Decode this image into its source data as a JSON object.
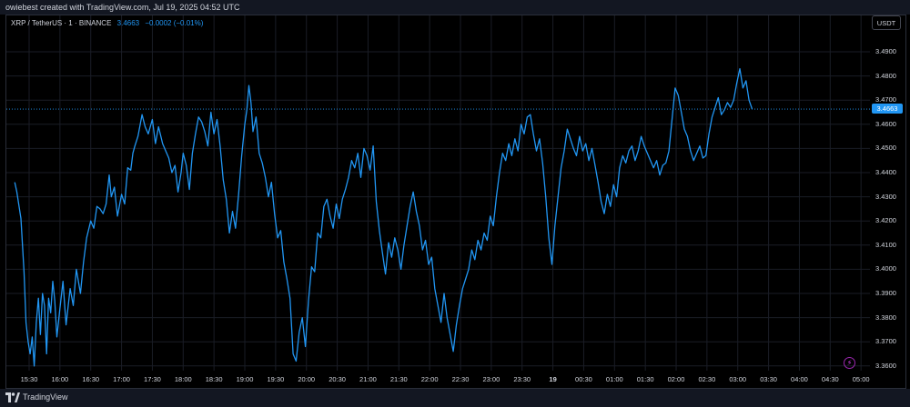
{
  "header": {
    "caption": "owiebest created with TradingView.com, Jul 19, 2025 04:52 UTC"
  },
  "legend": {
    "symbol": "XRP / TetherUS · 1 · BINANCE",
    "price": "3.4663",
    "change": "−0.0002 (−0.01%)"
  },
  "axis": {
    "currency": "USDT",
    "last_price_label": "3.4663"
  },
  "footer": {
    "brand": "TradingView"
  },
  "icons": {
    "logo": "tradingview-logo-icon",
    "replay": "lightning-icon"
  },
  "colors": {
    "line": "#2196f3",
    "background": "#000000",
    "grid": "#1a1d26"
  },
  "chart_data": {
    "type": "line",
    "title": "",
    "xlabel": "",
    "ylabel": "",
    "ylim": [
      3.355,
      3.4935
    ],
    "grid": true,
    "y_ticks": [
      "3.4900",
      "3.4800",
      "3.4700",
      "3.4600",
      "3.4500",
      "3.4400",
      "3.4300",
      "3.4200",
      "3.4100",
      "3.4000",
      "3.3900",
      "3.3800",
      "3.3700",
      "3.3600"
    ],
    "x_ticks": [
      "15:30",
      "16:00",
      "16:30",
      "17:00",
      "17:30",
      "18:00",
      "18:30",
      "19:00",
      "19:30",
      "20:00",
      "20:30",
      "21:00",
      "21:30",
      "22:00",
      "22:30",
      "23:00",
      "23:30",
      "19",
      "00:30",
      "01:00",
      "01:30",
      "02:00",
      "02:30",
      "03:00",
      "03:30",
      "04:00",
      "04:30",
      "05:00"
    ],
    "last_price": 3.4663,
    "series": [
      {
        "x_minutes_from_1530": [
          -14,
          -12,
          -8,
          -5,
          -3,
          -1,
          1,
          3,
          5,
          7,
          9,
          11,
          13,
          15,
          17,
          19,
          21,
          23,
          25,
          27,
          30,
          33,
          36,
          40,
          43,
          46,
          50,
          53,
          56,
          60,
          63,
          66,
          69,
          72,
          75,
          78,
          80,
          83,
          86,
          90,
          93,
          96,
          99,
          101,
          103,
          106,
          110,
          113,
          116,
          120,
          123,
          126,
          130,
          133,
          136,
          139,
          142,
          145,
          148,
          150,
          153,
          156,
          159,
          162,
          165,
          168,
          171,
          174,
          177,
          180,
          183,
          186,
          189,
          192,
          195,
          198,
          201,
          204,
          207,
          210,
          212,
          214,
          216,
          218,
          221,
          224,
          227,
          230,
          233,
          236,
          239,
          242,
          245,
          248,
          251,
          254,
          257,
          260,
          263,
          266,
          269,
          272,
          275,
          278,
          281,
          284,
          287,
          290,
          293,
          296,
          299,
          302,
          305,
          308,
          311,
          314,
          317,
          320,
          323,
          326,
          329,
          332,
          335,
          338,
          341,
          344,
          347,
          350,
          353,
          356,
          359,
          362,
          365,
          368,
          371,
          374,
          377,
          380,
          383,
          386,
          389,
          392,
          395,
          398,
          401,
          404,
          407,
          410,
          413,
          416,
          419,
          422,
          425,
          428,
          431,
          434,
          437,
          440,
          443,
          446,
          449,
          452,
          455,
          458,
          461,
          464,
          467,
          470,
          473,
          476,
          479,
          482,
          485,
          488,
          491,
          494,
          497,
          500,
          503,
          506,
          509,
          512,
          515,
          518,
          521,
          524,
          527,
          530,
          533,
          536,
          539,
          542,
          545,
          548,
          551,
          554,
          557,
          560,
          563,
          566,
          569,
          572,
          575,
          578,
          581,
          584,
          587,
          590,
          593,
          596,
          599,
          602,
          605,
          608,
          611,
          614,
          617,
          620,
          623,
          626,
          629,
          632,
          635,
          638,
          641,
          644,
          647,
          650,
          653,
          656,
          659,
          662,
          665,
          668,
          671,
          674,
          677,
          680,
          683,
          686,
          689,
          692,
          695,
          698,
          701,
          704,
          707,
          710,
          713,
          716,
          719,
          722,
          725,
          728,
          731,
          734,
          737,
          740,
          743,
          746,
          749,
          752,
          755,
          758,
          761,
          764,
          767,
          770,
          773,
          776,
          779,
          782,
          785,
          788,
          791,
          794,
          797,
          800,
          803
        ],
        "y": [
          3.436,
          3.432,
          3.421,
          3.399,
          3.378,
          3.37,
          3.365,
          3.372,
          3.36,
          3.378,
          3.388,
          3.373,
          3.39,
          3.385,
          3.365,
          3.388,
          3.382,
          3.395,
          3.387,
          3.372,
          3.384,
          3.395,
          3.377,
          3.392,
          3.385,
          3.4,
          3.39,
          3.403,
          3.413,
          3.42,
          3.417,
          3.426,
          3.425,
          3.423,
          3.427,
          3.439,
          3.43,
          3.434,
          3.422,
          3.431,
          3.427,
          3.442,
          3.441,
          3.448,
          3.451,
          3.455,
          3.464,
          3.459,
          3.456,
          3.462,
          3.452,
          3.459,
          3.452,
          3.449,
          3.446,
          3.44,
          3.443,
          3.432,
          3.44,
          3.448,
          3.443,
          3.433,
          3.448,
          3.456,
          3.463,
          3.461,
          3.457,
          3.451,
          3.465,
          3.456,
          3.462,
          3.451,
          3.437,
          3.429,
          3.415,
          3.424,
          3.417,
          3.431,
          3.447,
          3.46,
          3.466,
          3.476,
          3.469,
          3.457,
          3.463,
          3.448,
          3.444,
          3.438,
          3.43,
          3.436,
          3.423,
          3.413,
          3.416,
          3.403,
          3.396,
          3.388,
          3.365,
          3.362,
          3.374,
          3.38,
          3.368,
          3.387,
          3.401,
          3.399,
          3.415,
          3.413,
          3.426,
          3.429,
          3.422,
          3.417,
          3.427,
          3.421,
          3.429,
          3.433,
          3.438,
          3.445,
          3.442,
          3.448,
          3.438,
          3.45,
          3.447,
          3.441,
          3.451,
          3.428,
          3.416,
          3.407,
          3.398,
          3.411,
          3.405,
          3.413,
          3.408,
          3.4,
          3.41,
          3.418,
          3.426,
          3.432,
          3.424,
          3.418,
          3.408,
          3.412,
          3.402,
          3.405,
          3.392,
          3.385,
          3.378,
          3.39,
          3.38,
          3.373,
          3.366,
          3.377,
          3.385,
          3.392,
          3.396,
          3.4,
          3.408,
          3.404,
          3.412,
          3.408,
          3.415,
          3.412,
          3.422,
          3.418,
          3.43,
          3.44,
          3.448,
          3.445,
          3.452,
          3.447,
          3.454,
          3.449,
          3.46,
          3.456,
          3.463,
          3.464,
          3.456,
          3.449,
          3.454,
          3.444,
          3.43,
          3.413,
          3.402,
          3.418,
          3.43,
          3.442,
          3.449,
          3.458,
          3.454,
          3.45,
          3.447,
          3.455,
          3.449,
          3.452,
          3.445,
          3.45,
          3.443,
          3.436,
          3.428,
          3.423,
          3.431,
          3.426,
          3.435,
          3.43,
          3.442,
          3.447,
          3.444,
          3.449,
          3.451,
          3.445,
          3.449,
          3.455,
          3.451,
          3.448,
          3.445,
          3.442,
          3.445,
          3.439,
          3.443,
          3.444,
          3.449,
          3.462,
          3.475,
          3.472,
          3.465,
          3.458,
          3.455,
          3.449,
          3.445,
          3.448,
          3.451,
          3.446,
          3.447,
          3.456,
          3.463,
          3.467,
          3.471,
          3.464,
          3.466,
          3.469,
          3.467,
          3.47,
          3.477,
          3.483,
          3.475,
          3.478,
          3.47,
          3.4663
        ]
      }
    ]
  }
}
